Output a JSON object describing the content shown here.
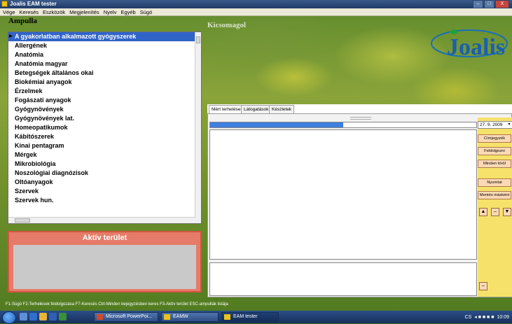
{
  "window": {
    "title": "Joalis EAM tester",
    "minimize": "–",
    "maximize": "□",
    "close": "X"
  },
  "menu": [
    "Vége",
    "Keresés",
    "Eszközök",
    "Megjelenítés",
    "Nyelv",
    "Egyéb",
    "Súgó"
  ],
  "ampulla": {
    "title": "Ampulla",
    "items": [
      "A gyakorlatban alkalmazott gyógyszerek",
      "Allergének",
      "Anatómia",
      "Anatómia magyar",
      "Betegségek általános okai",
      "Biokémiai anyagok",
      "Érzelmek",
      "Fogászati anyagok",
      "Gyógynövények",
      "Gyógynövények lat.",
      "Homeopatikumok",
      "Kábítószerek",
      "Kínai pentagram",
      "Mérgek",
      "Mikrobiológia",
      "Noszológiai diagnózisok",
      "Oltóanyagok",
      "Szervek",
      "Szervek hun."
    ],
    "selected_index": 0
  },
  "aktiv": {
    "title": "Aktív terület"
  },
  "kicsomagol": "Kicsomagol",
  "logo": {
    "text": "Joalis"
  },
  "tabs": [
    "Mért terhelések",
    "Látogatások",
    "Készletek"
  ],
  "progress": 0.5,
  "date": "27. 9. 2009",
  "date_dropdown": "▾",
  "buttons": {
    "cimjegyzek": "Címjegyzék",
    "feldolgozni": "Feldolgozni",
    "minden_torol": "Minden töröl",
    "nyomtat": "Nyomtat",
    "mentes_maskent": "Mentés másként",
    "up": "▲",
    "minus": "–",
    "down": "▼",
    "bottom_minus": "–"
  },
  "status": "F1-Súgó   F2-Terhelések feldolgozása   F7-Keresés   Ctrl-Minden bejegyzésben keres   F3-Aktív terület   ESC-ampullák listája",
  "taskbar": {
    "items": [
      "Microsoft PowerPoi...",
      "EAMW",
      "EAM tester"
    ],
    "lang": "CS",
    "clock": "10:09"
  }
}
